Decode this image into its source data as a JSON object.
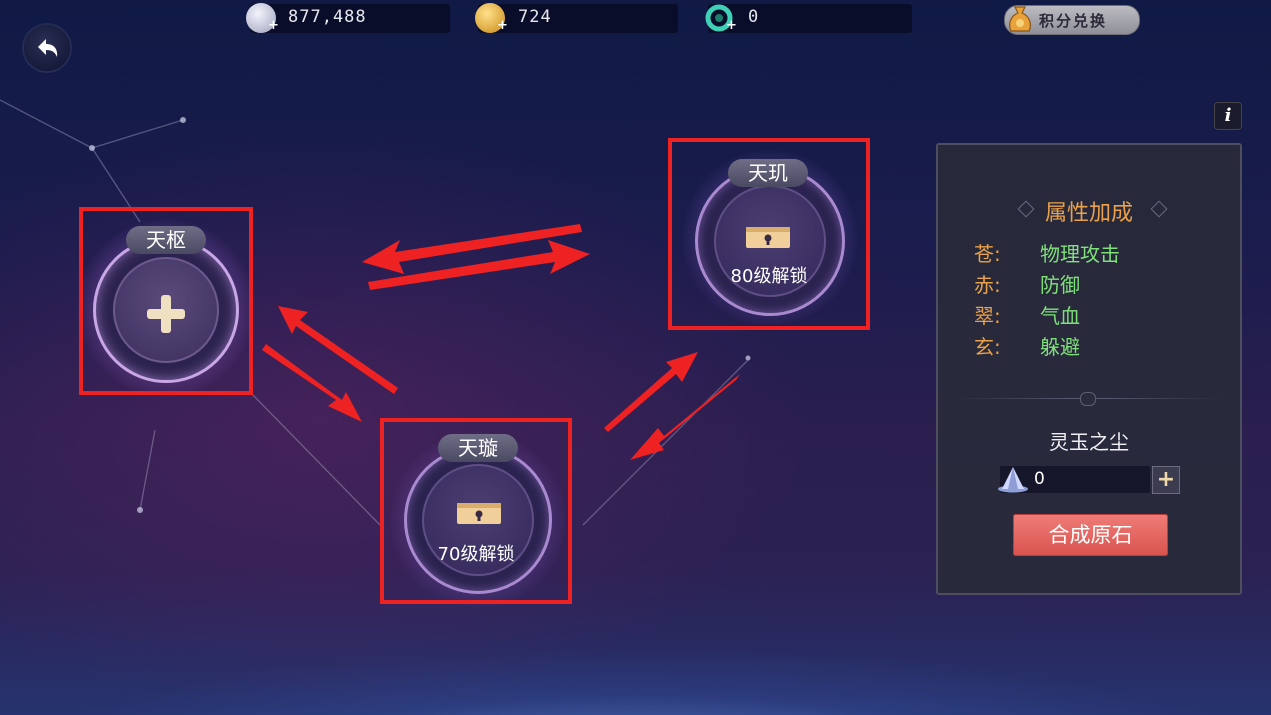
{
  "currencies": [
    {
      "name": "silver-coin",
      "value": "877,488",
      "color": "#cfd3e6"
    },
    {
      "name": "gold-coin",
      "value": "724",
      "color": "#e9b23d"
    },
    {
      "name": "jade-token",
      "value": "0",
      "color": "#3fd0b8"
    }
  ],
  "exchange": {
    "label": "积分兑换"
  },
  "info": {
    "glyph": "i"
  },
  "nodes": {
    "tianshu": {
      "name": "天枢",
      "icon": "plus-icon"
    },
    "tianxuan": {
      "name": "天璇",
      "unlock": "70级解锁",
      "icon": "lock-chest-icon"
    },
    "tianji": {
      "name": "天玑",
      "unlock": "80级解锁",
      "icon": "lock-chest-icon"
    }
  },
  "panel": {
    "title": "属性加成",
    "attributes": [
      {
        "key": "苍:",
        "value": "物理攻击"
      },
      {
        "key": "赤:",
        "value": "防御"
      },
      {
        "key": "翠:",
        "value": "气血"
      },
      {
        "key": "玄:",
        "value": "躲避"
      }
    ],
    "dust": {
      "title": "灵玉之尘",
      "value": "0",
      "plus": "+"
    },
    "synth_button": "合成原石"
  },
  "colors": {
    "highlight": "#ee2222",
    "attr_key": "#e9a14a",
    "attr_value": "#7fe07a",
    "synth": "#e5615c"
  }
}
